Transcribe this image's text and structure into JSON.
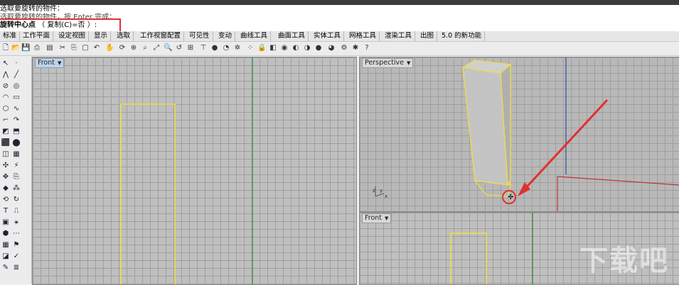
{
  "command": {
    "line1": "选取要旋转的物件：",
    "line2": "选取要旋转的物件，按 Enter 完成：",
    "prompt_bold": "旋转中心点",
    "prompt_rest": "（ 复制(C)=否 ）:"
  },
  "tabs": [
    "标准",
    "工作平面",
    "设定视图",
    "显示",
    "选取",
    "工作视窗配置",
    "可见性",
    "变动",
    "曲线工具",
    "曲面工具",
    "实体工具",
    "网格工具",
    "渲染工具",
    "出图",
    "5.0 的新功能"
  ],
  "viewports": {
    "front_main": "Front",
    "perspective": "Perspective",
    "front_small": "Front"
  },
  "axis_labels": {
    "z": "z",
    "y": "y",
    "x": "x"
  },
  "watermark": "下载吧",
  "colors": {
    "highlight": "#e03030",
    "curve": "#f0e040",
    "green_axis": "#2a8a2a",
    "red_axis": "#c03030",
    "blue_axis": "#3050a0"
  }
}
